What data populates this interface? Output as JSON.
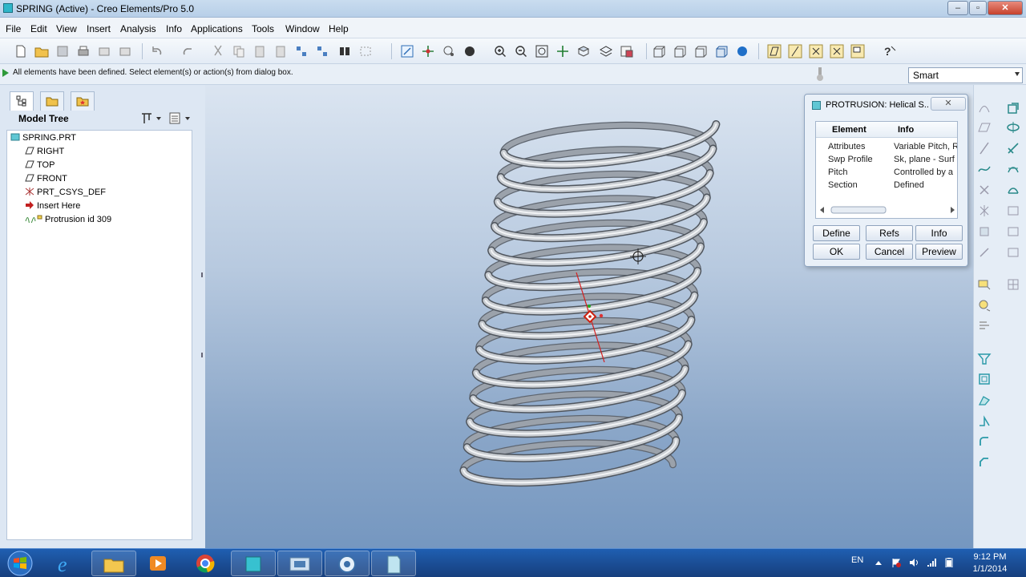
{
  "window": {
    "title": "SPRING (Active) - Creo Elements/Pro 5.0"
  },
  "menu": [
    "File",
    "Edit",
    "View",
    "Insert",
    "Analysis",
    "Info",
    "Applications",
    "Tools",
    "Window",
    "Help"
  ],
  "status": {
    "message": "All elements have been defined. Select element(s) or action(s) from dialog box."
  },
  "filter": {
    "value": "Smart"
  },
  "model_tree": {
    "header": "Model Tree",
    "items": [
      {
        "label": "SPRING.PRT",
        "icon": "part-icon"
      },
      {
        "label": "RIGHT",
        "icon": "datum-plane-icon"
      },
      {
        "label": "TOP",
        "icon": "datum-plane-icon"
      },
      {
        "label": "FRONT",
        "icon": "datum-plane-icon"
      },
      {
        "label": "PRT_CSYS_DEF",
        "icon": "csys-icon"
      },
      {
        "label": "Insert Here",
        "icon": "insert-arrow-icon"
      },
      {
        "label": "Protrusion id 309",
        "icon": "helical-sweep-icon"
      }
    ]
  },
  "dialog": {
    "title": "PROTRUSION: Helical S...",
    "columns": [
      "Element",
      "Info"
    ],
    "rows": [
      {
        "element": "Attributes",
        "info": "Variable Pitch, R"
      },
      {
        "element": "Swp Profile",
        "info": "Sk, plane - Surf"
      },
      {
        "element": "Pitch",
        "info": "Controlled by a"
      },
      {
        "element": "Section",
        "info": "Defined"
      }
    ],
    "buttons": {
      "define": "Define",
      "refs": "Refs",
      "info": "Info",
      "ok": "OK",
      "cancel": "Cancel",
      "preview": "Preview"
    }
  },
  "taskbar": {
    "apps": [
      "internet-explorer-icon",
      "file-explorer-icon",
      "media-player-icon",
      "chrome-icon",
      "creo-icon",
      "screen-capture-icon",
      "quicktime-icon",
      "notepad-icon"
    ],
    "language": "EN",
    "time": "9:12 PM",
    "date": "1/1/2014"
  },
  "colors": {
    "accent": "#2fb6c9",
    "viewport_top": "#dbe5f1",
    "viewport_bottom": "#7597c0",
    "spring": "#c9cdd2",
    "taskbar": "#1b4e96"
  }
}
